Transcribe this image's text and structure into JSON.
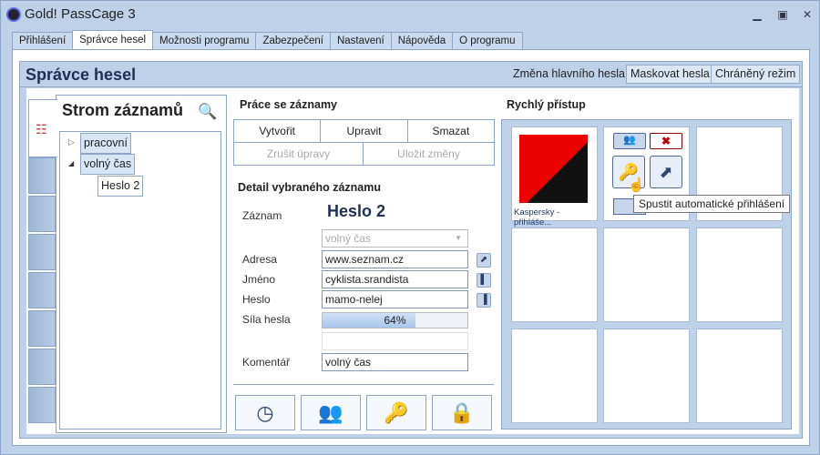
{
  "window": {
    "title": "Gold! PassCage 3",
    "controls": [
      "minimize",
      "maximize",
      "close"
    ]
  },
  "tabs": [
    "Přihlášení",
    "Správce hesel",
    "Možnosti programu",
    "Zabezpečení",
    "Nastavení",
    "Nápověda",
    "O programu"
  ],
  "active_tab": "Správce hesel",
  "header": {
    "title": "Správce hesel",
    "change_master": "Změna hlavního hesla",
    "mask": "Maskovat hesla",
    "protected": "Chráněný režim"
  },
  "tree": {
    "title": "Strom záznamů",
    "nodes": [
      {
        "label": "pracovní"
      },
      {
        "label": "volný čas"
      },
      {
        "label": "Heslo 2"
      }
    ]
  },
  "records": {
    "title": "Práce se záznamy",
    "create": "Vytvořit",
    "edit": "Upravit",
    "delete": "Smazat",
    "cancel": "Zrušit úpravy",
    "save": "Uložit změny"
  },
  "detail": {
    "title": "Detail vybraného záznamu",
    "record_label": "Záznam",
    "record_name": "Heslo 2",
    "category": "volný čas",
    "address_label": "Adresa",
    "address": "www.seznam.cz",
    "name_label": "Jméno",
    "name": "cyklista.srandista",
    "password_label": "Heslo",
    "password": "mamo-nelej",
    "strength_label": "Síla hesla",
    "strength_text": "64%",
    "strength": 64,
    "comment_label": "Komentář",
    "comment": "volný čas"
  },
  "quick": {
    "title": "Rychlý přístup",
    "item_label": "Kaspersky - přihláše...",
    "tooltip": "Spustit automatické přihlášení"
  }
}
